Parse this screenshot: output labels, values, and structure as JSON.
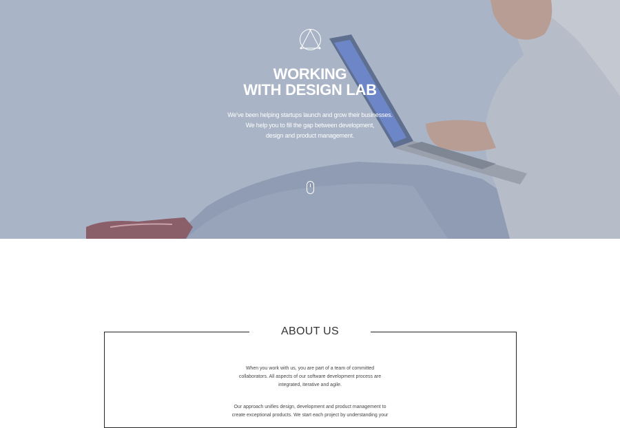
{
  "hero": {
    "title_line1": "WORKING",
    "title_line2": "WITH DESIGN LAB",
    "subtitle_lines": [
      "We've been helping startups launch and grow their businesses.",
      "We help you to fill the gap between development,",
      "design and product management."
    ],
    "overlay_color": "#a9b4c6",
    "logo_icon": "triangle-circle-logo-icon",
    "scroll_icon": "mouse-scroll-icon"
  },
  "about": {
    "heading": "ABOUT US",
    "paragraph1_lines": [
      "When you work with us, you are part of a team of committed",
      "collaborators. All aspects of our software development process are",
      "integrated, iterative and agile."
    ],
    "paragraph2_lines": [
      "Our approach unifies design, development and product management to",
      "create exceptional products. We start each project by understanding your"
    ]
  }
}
